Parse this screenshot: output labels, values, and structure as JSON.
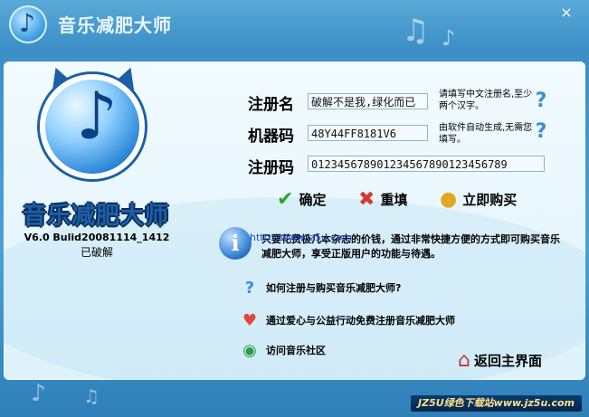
{
  "window": {
    "title": "音乐减肥大师",
    "close_glyph": "×"
  },
  "brand": {
    "app_name": "音乐减肥大师",
    "version": "V6.0 Bulid20081114_1412",
    "crack_note": "已破解"
  },
  "form": {
    "reg_name": {
      "label": "注册名",
      "value": "破解不是我,绿化而已",
      "hint": "请填写中文注册名,至少两个汉字。"
    },
    "machine_code": {
      "label": "机器码",
      "value": "48Y44FF8181V6",
      "hint": "由软件自动生成,无需您填写。"
    },
    "reg_code": {
      "label": "注册码",
      "value": "01234567890123456789012345678​9"
    }
  },
  "buttons": {
    "ok": "确定",
    "reset": "重填",
    "buy": "立即购买",
    "home": "返回主界面"
  },
  "info": {
    "url_overlay": "http://www.jz5u.com",
    "text": "只要花费极几本杂志的价钱，通过非常快捷方便的方式即可购买音乐减肥大师，享受正版用户的功能与待遇。"
  },
  "links": {
    "how_to": "如何注册与购买音乐减肥大师?",
    "charity": "通过爱心与公益行动免费注册音乐减肥大师",
    "community": "访问音乐社区"
  },
  "watermark": "JZ5U绿色下载站www.jz5u.com",
  "colors": {
    "title_blue": "#3b8fc6",
    "panel_bg": "#e7f6fd",
    "ok_green": "#2aa52a",
    "reset_red": "#d43a2f",
    "buy_gold": "#e0a81c"
  }
}
